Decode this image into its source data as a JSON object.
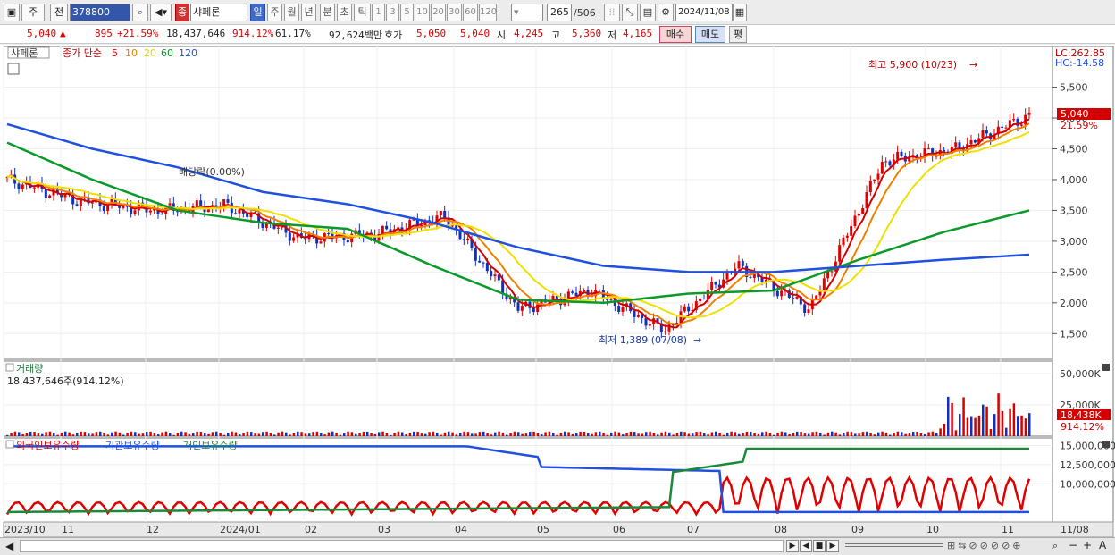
{
  "toolbar": {
    "market": "주",
    "type": "전",
    "code": "378800",
    "stock_name": "샤페론",
    "stock_badge": "종",
    "periods": [
      "일",
      "주",
      "월",
      "년",
      "분",
      "초",
      "틱"
    ],
    "intervals": [
      "1",
      "3",
      "5",
      "10",
      "20",
      "30",
      "60",
      "120"
    ],
    "count": "265",
    "total": "/506",
    "date": "2024/11/08"
  },
  "quote": {
    "price": "5,040",
    "change": "895",
    "change_pct": "+21.59%",
    "volume": "18,437,646",
    "vol_ratio": "914.12%",
    "turnover": "61.17%",
    "amount": "92,624백만",
    "ask_label": "호가",
    "ask1": "5,050",
    "ask2": "5,040",
    "open_label": "시",
    "open": "4,245",
    "high_label": "고",
    "high": "5,360",
    "low_label": "저",
    "low": "4,165",
    "buy": "매수",
    "sell": "매도",
    "eval": "평"
  },
  "price_panel": {
    "stock": "샤페론",
    "ma_title": "종가 단순",
    "ma_periods": [
      "5",
      "10",
      "20",
      "60",
      "120"
    ],
    "ma_colors": [
      "#d40000",
      "#f08000",
      "#f0e000",
      "#0a9a2a",
      "#2050e0"
    ],
    "dividend": "배당락(0.00%)",
    "max_label": "최고 5,900 (10/23)",
    "min_label": "최저 1,389 (07/08)",
    "lc": "LC:262.85",
    "hc": "HC:-14.58",
    "price_tag": "5,040",
    "pct_tag": "21.59%",
    "y_ticks": [
      "5,500",
      "5,000",
      "4,500",
      "4,000",
      "3,500",
      "3,000",
      "2,500",
      "2,000",
      "1,500"
    ]
  },
  "volume_panel": {
    "title": "거래량",
    "value": "18,437,646주(914.12%)",
    "y_ticks": [
      "50,000K",
      "25,000K"
    ],
    "tag": "18,438K",
    "tag_pct": "914.12%"
  },
  "holders_panel": {
    "titles": [
      "외국인보유수량",
      "기관보유수량",
      "개인보유수량"
    ],
    "colors": [
      "#e00000",
      "#2050e0",
      "#1a8a3a"
    ],
    "y_ticks": [
      "15,000,000",
      "12,500,000",
      "10,000,000"
    ]
  },
  "x_axis": [
    "2023/10",
    "11",
    "12",
    "2024/01",
    "02",
    "03",
    "04",
    "05",
    "06",
    "07",
    "08",
    "09",
    "10",
    "11",
    "11/08"
  ],
  "chart_data": {
    "type": "line",
    "months": [
      "2023/10",
      "11",
      "12",
      "2024/01",
      "02",
      "03",
      "04",
      "05",
      "06",
      "07",
      "08",
      "09",
      "10",
      "11"
    ],
    "close": [
      4000,
      3650,
      3500,
      3580,
      3050,
      3100,
      3400,
      1900,
      2200,
      1550,
      2600,
      1900,
      4300,
      4500,
      5040
    ],
    "ma120": [
      4900,
      4500,
      4200,
      3800,
      3600,
      3300,
      2900,
      2600,
      2500,
      2500,
      2600,
      2700,
      2780
    ],
    "ma60": [
      4600,
      4000,
      3500,
      3300,
      3200,
      2600,
      2050,
      2000,
      2150,
      2200,
      2700,
      3150,
      3500
    ],
    "volume_max_k": 60000,
    "volume_last_k": 18438,
    "max_high": 5900,
    "min_low": 1389
  },
  "scrollbar": {
    "play": "▶",
    "zoom_in": "+",
    "zoom_out": "−",
    "font": "A"
  }
}
